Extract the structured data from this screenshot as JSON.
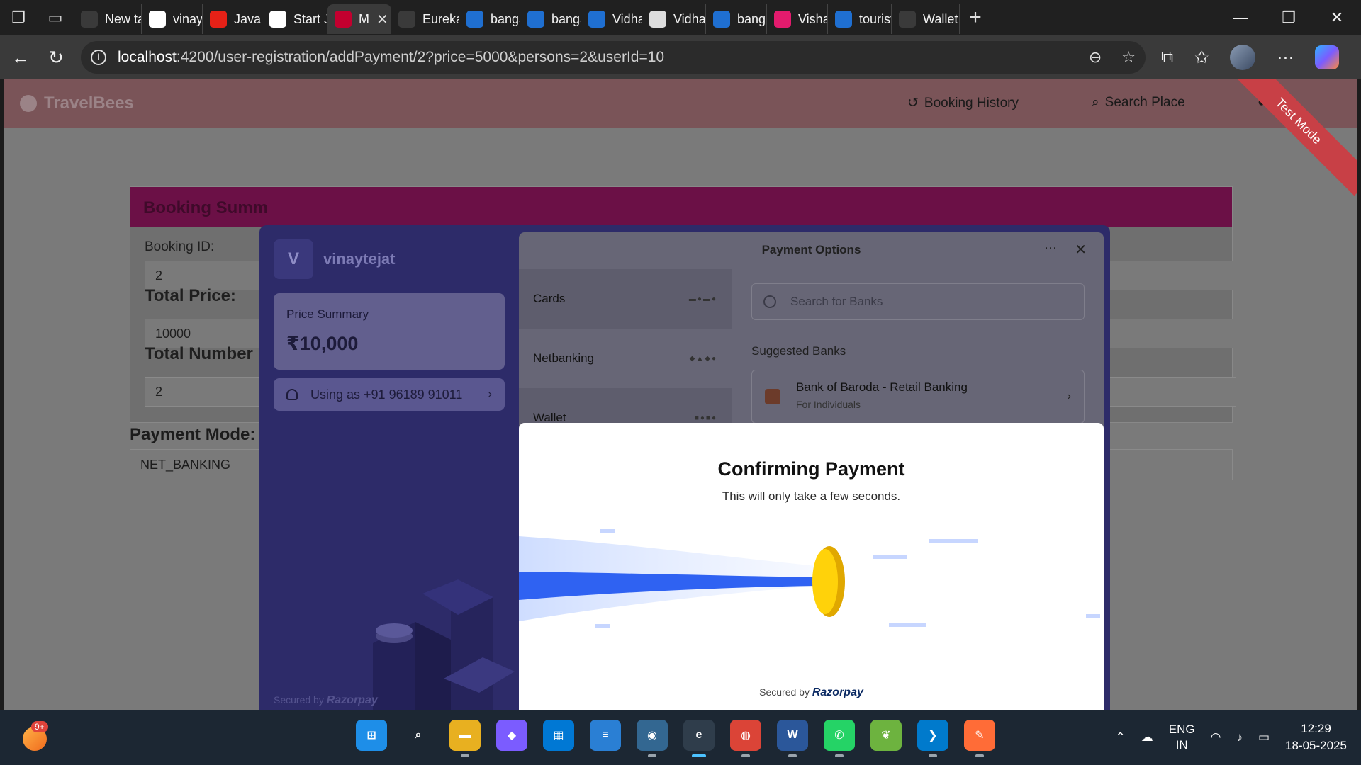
{
  "browser": {
    "tabs": [
      {
        "label": "New ta",
        "icon": "newtab-icon",
        "color": "#3a3a3a"
      },
      {
        "label": "vinayst",
        "icon": "github-icon",
        "color": "#ffffff"
      },
      {
        "label": "Java Sp",
        "icon": "youtube-icon",
        "color": "#e62117"
      },
      {
        "label": "Start Ja",
        "icon": "chatgpt-icon",
        "color": "#ffffff"
      },
      {
        "label": "M",
        "icon": "angular-icon",
        "color": "#c3002f"
      },
      {
        "label": "Eureka",
        "icon": "globe-icon",
        "color": "#3a3a3a"
      },
      {
        "label": "bangal",
        "icon": "bing-search-icon",
        "color": "#1f6fd1"
      },
      {
        "label": "bangal",
        "icon": "bing-search-icon",
        "color": "#1f6fd1"
      },
      {
        "label": "Vidhar",
        "icon": "bing-search-icon",
        "color": "#1f6fd1"
      },
      {
        "label": "Vidhar",
        "icon": "wikipedia-icon",
        "color": "#dddddd"
      },
      {
        "label": "banga",
        "icon": "bing-search-icon",
        "color": "#1f6fd1"
      },
      {
        "label": "Vishala",
        "icon": "app-icon",
        "color": "#e31b6d"
      },
      {
        "label": "tourist",
        "icon": "bing-search-icon",
        "color": "#1f6fd1"
      },
      {
        "label": "Wallet",
        "icon": "wallet-icon",
        "color": "#3a3a3a"
      }
    ],
    "url_host": "localhost",
    "url_path": ":4200/user-registration/addPayment/2?price=5000&persons=2&userId=10"
  },
  "app": {
    "brand": "TravelBees",
    "nav": {
      "booking_history": "Booking History",
      "search_place": "Search Place",
      "profile": "le"
    },
    "test_mode": "Test Mode",
    "booking": {
      "title": "Booking Summ",
      "booking_id_label": "Booking ID:",
      "booking_id": "2",
      "total_price_label": "Total Price:",
      "total_price": "10000",
      "total_number_label": "Total Number",
      "total_number": "2",
      "payment_mode_label": "Payment Mode:",
      "payment_mode": "NET_BANKING"
    }
  },
  "razorpay": {
    "merchant_initial": "V",
    "merchant_name": "vinaytejat",
    "price_summary_label": "Price Summary",
    "price": "₹10,000",
    "using_as": "Using as +91 96189 91011",
    "secured_by": "Secured by",
    "razorpay": "Razorpay",
    "payment_options_title": "Payment Options",
    "methods": [
      {
        "label": "Cards"
      },
      {
        "label": "Netbanking"
      },
      {
        "label": "Wallet"
      }
    ],
    "search_placeholder": "Search for Banks",
    "suggested_banks_title": "Suggested Banks",
    "bank_name": "Bank of Baroda - Retail Banking",
    "bank_sub": "For Individuals",
    "confirm_title": "Confirming Payment",
    "confirm_sub": "This will only take a few seconds."
  },
  "taskbar": {
    "notification_badge": "9+",
    "lang_1": "ENG",
    "lang_2": "IN",
    "time": "12:29",
    "date": "18-05-2025"
  }
}
